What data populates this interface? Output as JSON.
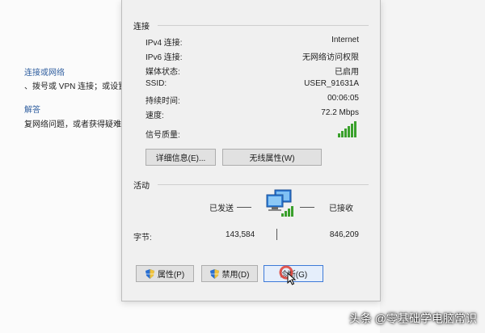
{
  "background": {
    "link1": "连接或网络",
    "desc1": "、拨号或 VPN 连接；或设置",
    "link2": "解答",
    "desc2": "复网络问题，或者获得疑难解"
  },
  "dialog": {
    "connection_group": "连接",
    "rows": [
      {
        "label": "IPv4 连接:",
        "value": "Internet"
      },
      {
        "label": "IPv6 连接:",
        "value": "无网络访问权限"
      },
      {
        "label": "媒体状态:",
        "value": "已启用"
      },
      {
        "label": "SSID:",
        "value": "USER_91631A"
      },
      {
        "label": "持续时间:",
        "value": "00:06:05"
      },
      {
        "label": "速度:",
        "value": "72.2 Mbps"
      }
    ],
    "signal_label": "信号质量:",
    "details_button": "详细信息(E)...",
    "wireless_props_button": "无线属性(W)",
    "activity_group": "活动",
    "sent_label": "已发送",
    "received_label": "已接收",
    "bytes_label": "字节:",
    "bytes_sent": "143,584",
    "bytes_received": "846,209",
    "properties_button": "属性(P)",
    "disable_button": "禁用(D)",
    "diagnose_button": "诊断(G)"
  },
  "watermark": "头条 @零基础学电脑常识",
  "colors": {
    "link": "#2f5e9f",
    "signal": "#3aa02c",
    "focus": "#3d7ad8"
  }
}
